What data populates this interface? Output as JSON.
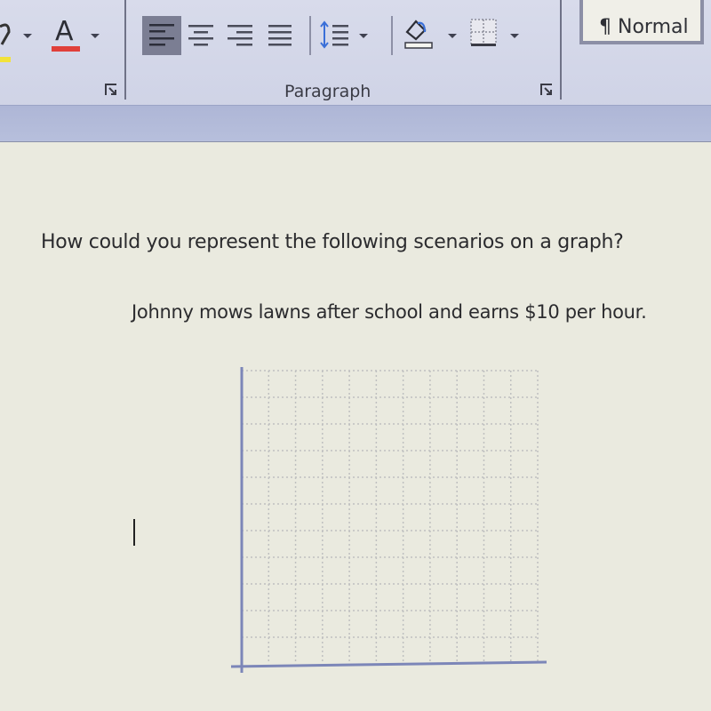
{
  "ribbon": {
    "font_group": {
      "highlight_label": "Text Highlight Color",
      "font_color_glyph": "A",
      "font_color_label": "Font Color",
      "highlight_color": "#f2e23a",
      "font_color": "#e0403a"
    },
    "paragraph_group": {
      "label": "Paragraph",
      "buttons": [
        {
          "name": "align-left",
          "label": "Align Left",
          "active": true
        },
        {
          "name": "center",
          "label": "Center",
          "active": false
        },
        {
          "name": "align-right",
          "label": "Align Right",
          "active": false
        },
        {
          "name": "justify",
          "label": "Justify",
          "active": false
        },
        {
          "name": "line-spacing",
          "label": "Line and Paragraph Spacing",
          "active": false
        },
        {
          "name": "shading",
          "label": "Shading",
          "active": false
        },
        {
          "name": "borders",
          "label": "Borders",
          "active": false
        }
      ]
    },
    "styles_group": {
      "current_style": "¶ Normal"
    },
    "colors": {
      "accent_blue": "#3a6fd8",
      "active_button": "#7b7e93"
    }
  },
  "document": {
    "question": "How could you represent the following scenarios on a graph?",
    "scenario": "Johnny mows lawns after school and earns $10 per hour.",
    "graph": {
      "description": "Blank coordinate grid with x and y axes, no labels or data",
      "grid_columns": 11,
      "grid_rows": 11,
      "axis_color": "#7c86b8",
      "grid_color": "#bfc0c0"
    }
  }
}
